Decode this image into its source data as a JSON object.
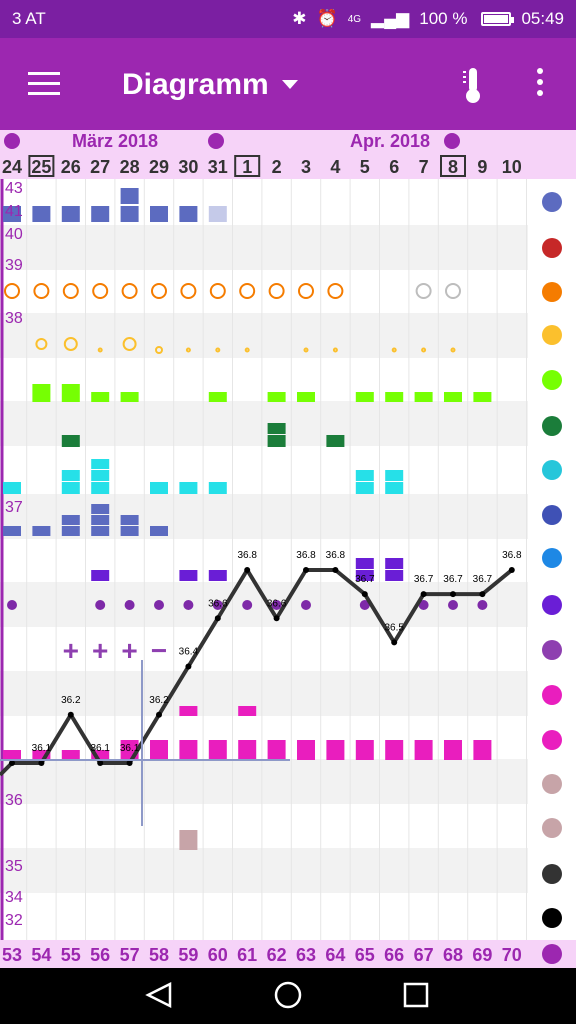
{
  "status_bar": {
    "carrier": "3 AT",
    "network": "4G",
    "battery": "100 %",
    "time": "05:49"
  },
  "app_bar": {
    "title": "Diagramm",
    "menu_icon": "hamburger-menu-icon",
    "thermometer_icon": "thermometer-icon",
    "more_icon": "more-vert-icon"
  },
  "colors": {
    "statusbar": "#7b1fa2",
    "appbar": "#9c27b0",
    "band": "#f6d3f8",
    "accent": "#9c27b0",
    "temp_line": "#333333",
    "blue": "#5c6bc0",
    "green": "#76ff03",
    "darkgreen": "#1b7d3a",
    "cyan": "#26e0e8",
    "purple": "#6a1ed6",
    "dotpurple": "#7e2aa8",
    "magenta": "#e91ebe",
    "orange": "#f57c00",
    "yellow": "#fbc02d",
    "gray": "#bdbdbd",
    "mauve": "#c7a4a8"
  },
  "months": [
    {
      "label": "März 2018"
    },
    {
      "label": "Apr. 2018"
    }
  ],
  "dates": [
    "24",
    "25",
    "26",
    "27",
    "28",
    "29",
    "30",
    "31",
    "1",
    "2",
    "3",
    "4",
    "5",
    "6",
    "7",
    "8",
    "9",
    "10"
  ],
  "boxed_dates": [
    "25",
    "1",
    "8"
  ],
  "cycle_days": [
    "53",
    "54",
    "55",
    "56",
    "57",
    "58",
    "59",
    "60",
    "61",
    "62",
    "63",
    "64",
    "65",
    "66",
    "67",
    "68",
    "69",
    "70"
  ],
  "left_axis": [
    "43",
    "41",
    "40",
    "39",
    "38",
    "37",
    "36",
    "35",
    "34",
    "32"
  ],
  "chart_data": {
    "type": "line",
    "series": [
      {
        "values": [
          36.0,
          36.0,
          36.2,
          36.0,
          36.0,
          36.2,
          36.4,
          36.6,
          36.8,
          36.6,
          36.8,
          36.8,
          36.7,
          36.5,
          36.7,
          36.7,
          36.7,
          36.8
        ]
      }
    ],
    "point_labels": [
      "",
      "36.1",
      "36.2",
      "36.1",
      "36.1",
      "36.2",
      "36.4",
      "36.6",
      "36.8",
      "36.6",
      "36.8",
      "36.8",
      "36.7",
      "36.5",
      "36.7",
      "36.7",
      "36.7",
      "36.8"
    ],
    "marks": [
      "+",
      "+",
      "+",
      "−"
    ]
  },
  "side_icons": [
    "flower-icon",
    "blood-drop-icon",
    "splash-icon",
    "cervix-icon",
    "heart-icon",
    "headache-icon",
    "breast-icon",
    "sun-icon",
    "water-drop-icon",
    "document-icon",
    "flower-gear-icon",
    "pose-icon",
    "bag-icon",
    "head-icon",
    "balloon-icon",
    "settings-icon",
    "person-icon",
    "cycle-icon"
  ],
  "nav": {
    "back": "back-icon",
    "home": "home-icon",
    "recents": "recents-icon"
  }
}
